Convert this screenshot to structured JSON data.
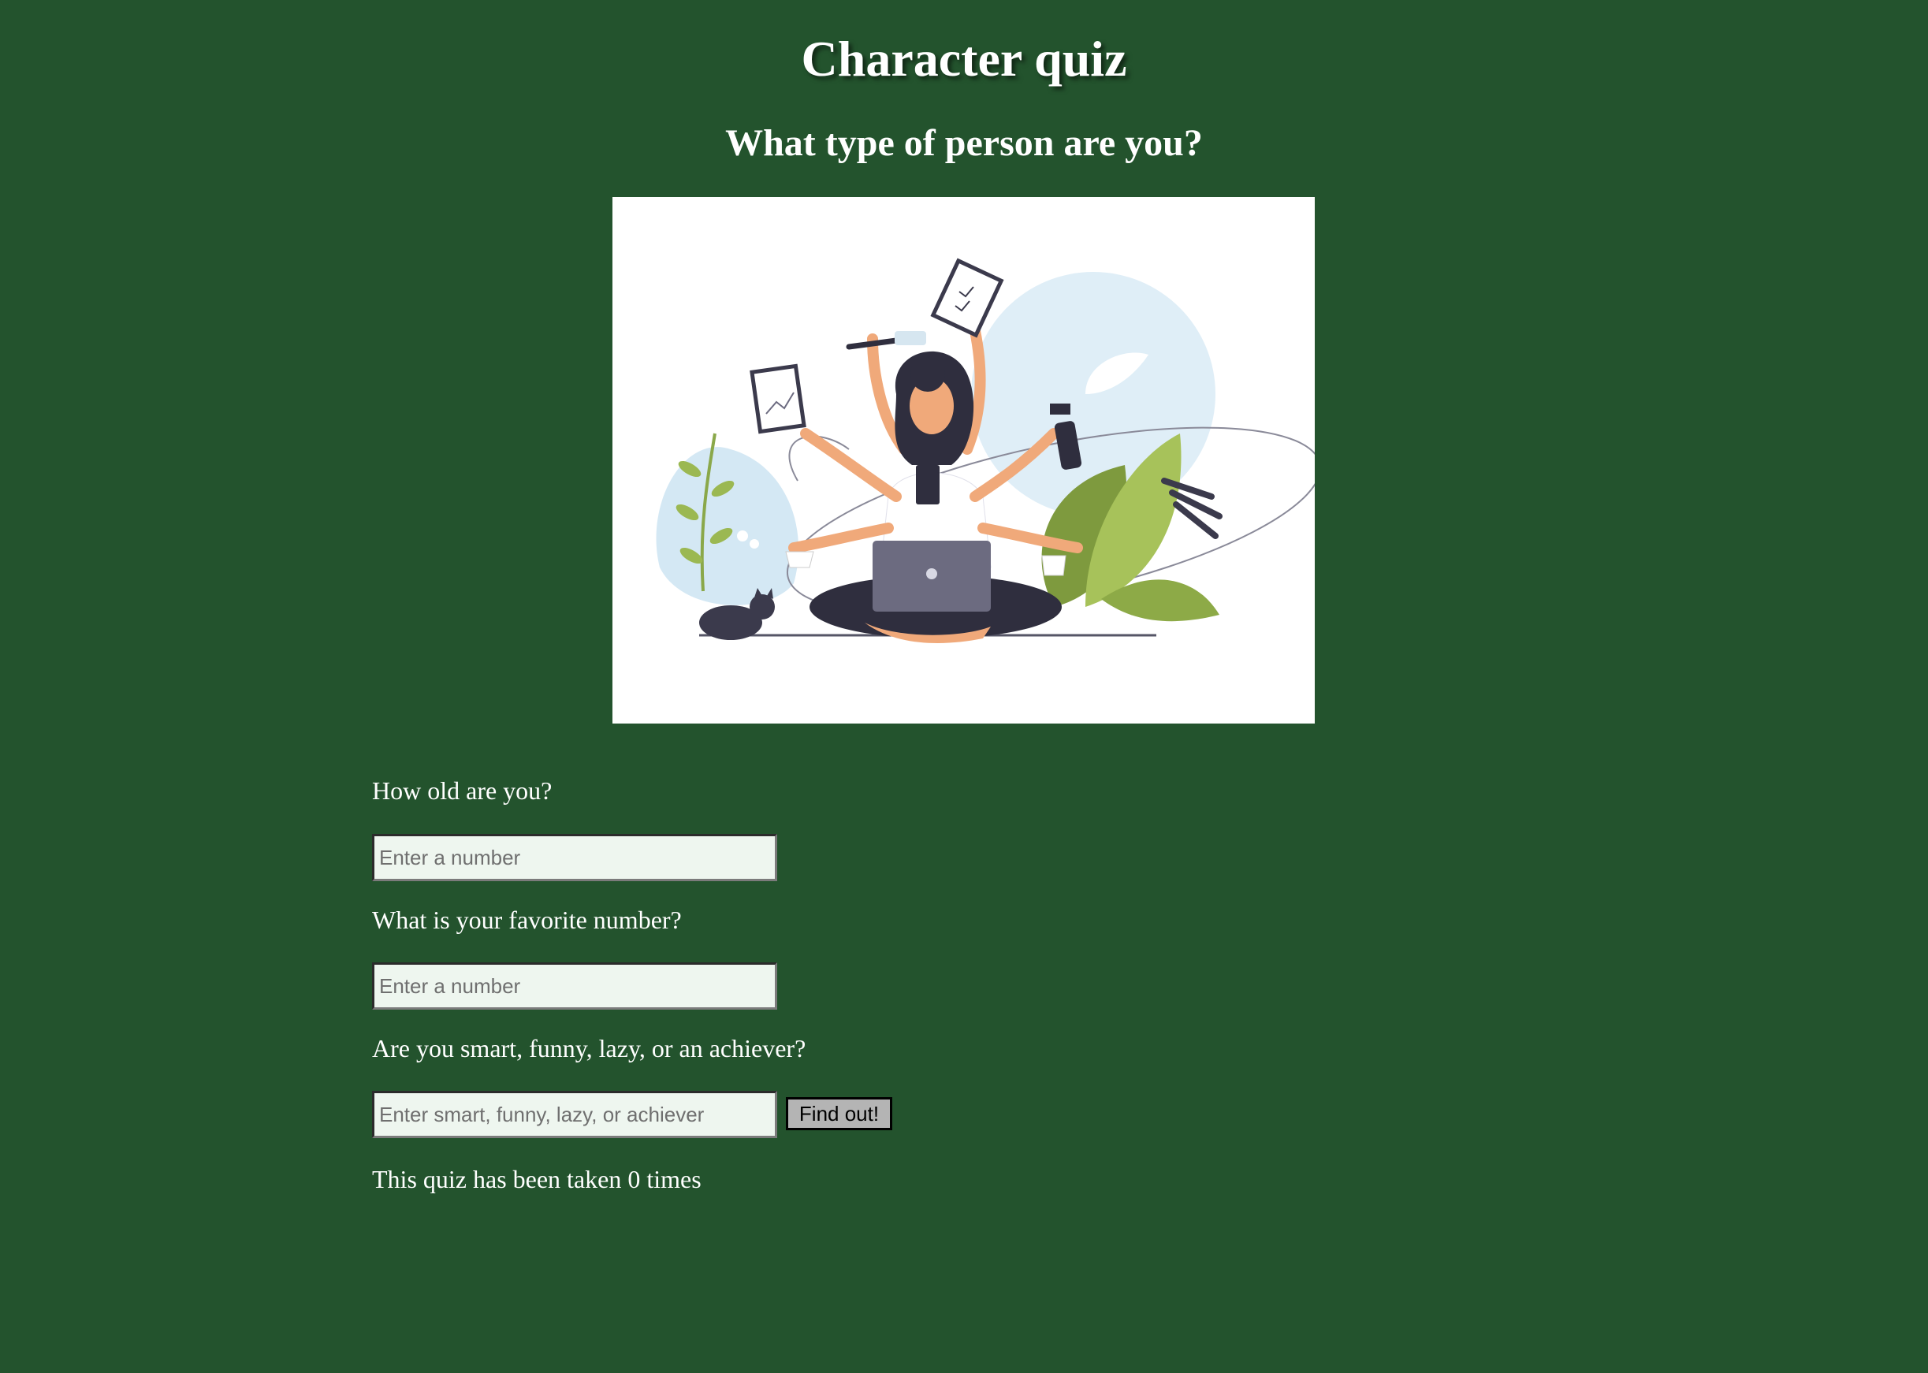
{
  "header": {
    "title": "Character quiz",
    "subtitle": "What type of person are you?"
  },
  "hero_image": {
    "description_icon": "multitasking-woman-illustration"
  },
  "questions": [
    {
      "label": "How old are you?",
      "placeholder": "Enter a number"
    },
    {
      "label": "What is your favorite number?",
      "placeholder": "Enter a number"
    },
    {
      "label": "Are you smart, funny, lazy, or an achiever?",
      "placeholder": "Enter smart, funny, lazy, or achiever"
    }
  ],
  "submit_label": "Find out!",
  "counter_text": "This quiz has been taken 0 times",
  "colors": {
    "background": "#23532d",
    "text": "#ffffff",
    "input_bg": "#eef6ef",
    "button_bg": "#b4b4b4"
  }
}
